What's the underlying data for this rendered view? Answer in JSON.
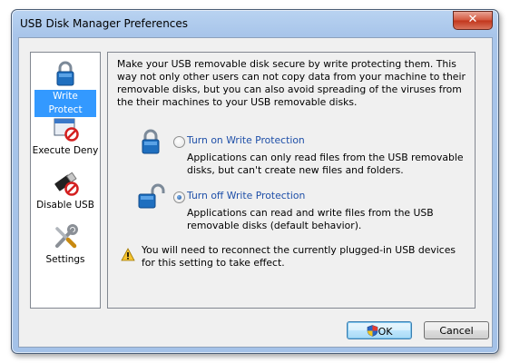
{
  "window": {
    "title": "USB Disk Manager Preferences",
    "close_label": "✕"
  },
  "sidebar": {
    "items": [
      {
        "label": "Write Protect",
        "icon": "lock-icon",
        "selected": true
      },
      {
        "label": "Execute Deny",
        "icon": "window-deny-icon",
        "selected": false
      },
      {
        "label": "Disable USB",
        "icon": "usb-disabled-icon",
        "selected": false
      },
      {
        "label": "Settings",
        "icon": "tools-icon",
        "selected": false
      }
    ]
  },
  "panel": {
    "intro": "Make your USB removable disk secure by write protecting them. This way not only other users can not copy data from your machine to their removable disks, but you can also avoid spreading of the viruses from the their machines to your USB removable disks.",
    "options": [
      {
        "label": "Turn on Write Protection",
        "description": "Applications can only read files from the USB removable disks, but can't create new files and folders.",
        "checked": false,
        "icon": "lock-closed-icon"
      },
      {
        "label": "Turn off Write Protection",
        "description": "Applications can read and write files from the USB removable disks (default behavior).",
        "checked": true,
        "icon": "lock-open-icon"
      }
    ],
    "warning": "You will need to reconnect the currently plugged-in USB devices for this setting to take effect."
  },
  "buttons": {
    "ok": "OK",
    "cancel": "Cancel"
  },
  "colors": {
    "selection": "#3399ff",
    "link_blue": "#1e4fa8",
    "accent_lock": "#1f6fbf"
  }
}
